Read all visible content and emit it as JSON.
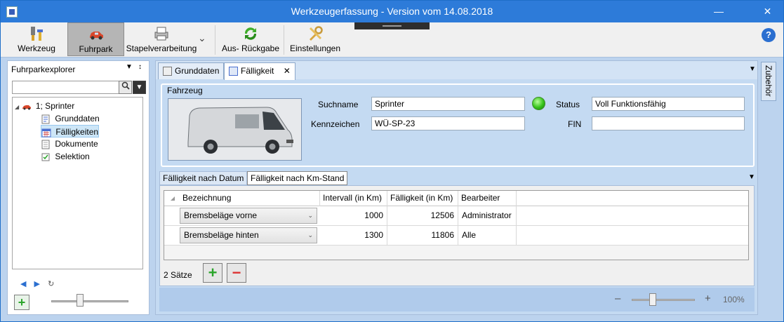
{
  "window": {
    "title": "Werkzeugerfassung - Version vom 14.08.2018",
    "minimize": "—",
    "maximize": "☐",
    "close": "✕"
  },
  "ribbon": {
    "items": [
      {
        "label": "Werkzeug",
        "icon": "tools-icon"
      },
      {
        "label": "Fuhrpark",
        "icon": "car-icon",
        "active": true
      },
      {
        "label": "Stapelverarbeitung",
        "icon": "printer-stack-icon"
      },
      {
        "label": "Aus- Rückgabe",
        "icon": "refresh-arrows-icon"
      },
      {
        "label": "Einstellungen",
        "icon": "settings-tools-icon"
      }
    ],
    "more": "⌄",
    "help": "?"
  },
  "explorer": {
    "title": "Fuhrparkexplorer",
    "dropdown": "▼",
    "pin": "↕",
    "search_value": "",
    "search_btn": "🔍",
    "filter_btn": "▼",
    "tree": {
      "root": "1; Sprinter",
      "expander": "◢",
      "children": [
        "Grunddaten",
        "Fälligkeiten",
        "Dokumente",
        "Selektion"
      ]
    },
    "nav_prev": "◀",
    "nav_next": "▶",
    "add": "+"
  },
  "tabs": [
    {
      "label": "Grunddaten"
    },
    {
      "label": "Fälligkeit",
      "close": "✕"
    }
  ],
  "fahrzeug": {
    "group_title": "Fahrzeug",
    "suchname_label": "Suchname",
    "suchname_value": "Sprinter",
    "status_label": "Status",
    "status_value": "Voll Funktionsfähig",
    "status_color": "#36c21a",
    "kennzeichen_label": "Kennzeichen",
    "kennzeichen_value": "WÜ-SP-23",
    "fin_label": "FIN",
    "fin_value": ""
  },
  "subtabs": [
    "Fälligkeit nach Datum",
    "Fälligkeit nach Km-Stand"
  ],
  "grid": {
    "columns": [
      "Bezeichnung",
      "Intervall (in Km)",
      "Fälligkeit (in Km)",
      "Bearbeiter"
    ],
    "rows": [
      {
        "bezeichnung": "Bremsbeläge vorne",
        "intervall": "1000",
        "faelligkeit": "12506",
        "bearbeiter": "Administrator"
      },
      {
        "bezeichnung": "Bremsbeläge hinten",
        "intervall": "1300",
        "faelligkeit": "11806",
        "bearbeiter": "Alle"
      }
    ],
    "count_label": "2  Sätze",
    "add": "+",
    "remove": "−"
  },
  "zoom": {
    "minus": "–",
    "plus": "+",
    "percent": "100%"
  },
  "side_panel": "Zubehör"
}
